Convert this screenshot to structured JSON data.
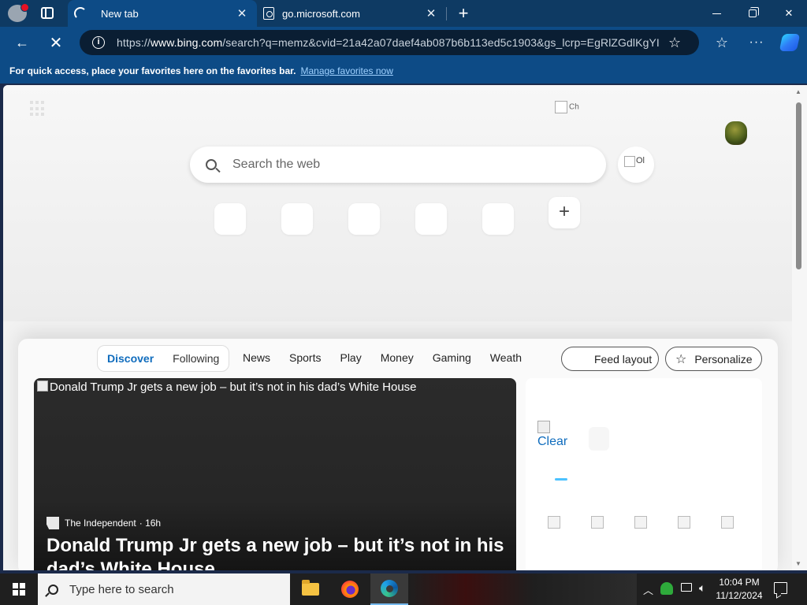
{
  "browser": {
    "tabs": [
      {
        "title": "New tab",
        "state": "loading",
        "active": true
      },
      {
        "title": "go.microsoft.com",
        "active": false
      }
    ],
    "address": {
      "prefix": "https://",
      "domain": "www.bing.com",
      "path": "/search?q=memz&cvid=21a42a07daef4ab087b6b113ed5c1903&gs_lcrp=EgRlZGdlKgYI..."
    },
    "favorites_bar": {
      "message": "For quick access, place your favorites here on the favorites bar.",
      "link": "Manage favorites now"
    },
    "icons": {
      "back": "back-arrow-icon",
      "stop": "stop-icon",
      "favorites": "favorites-icon",
      "more": "more-icon",
      "copilot": "copilot-icon"
    }
  },
  "newtab": {
    "search_placeholder": "Search the web",
    "visual_search_alt": "Ol",
    "broken_image_alt": "Ch",
    "feed": {
      "pills": [
        "Discover",
        "Following"
      ],
      "nav": [
        "News",
        "Sports",
        "Play",
        "Money",
        "Gaming",
        "Weather"
      ],
      "feed_layout_label": "Feed layout",
      "personalize_label": "Personalize"
    },
    "hero": {
      "image_alt": "Donald Trump Jr gets a new job – but it’s not in his dad’s White House",
      "source": "The Independent",
      "age": "· 16h",
      "title": "Donald Trump Jr gets a new job – but it’s not in his dad’s White House"
    },
    "weather": {
      "image_alt": "Clear"
    }
  },
  "taskbar": {
    "search_placeholder": "Type here to search",
    "time": "10:04 PM",
    "date": "11/12/2024"
  },
  "colors": {
    "titlebar": "#0e3a63",
    "toolbar": "#0d4b86",
    "accent_link": "#0f6cbd",
    "taskbar": "#1f1f1f"
  }
}
